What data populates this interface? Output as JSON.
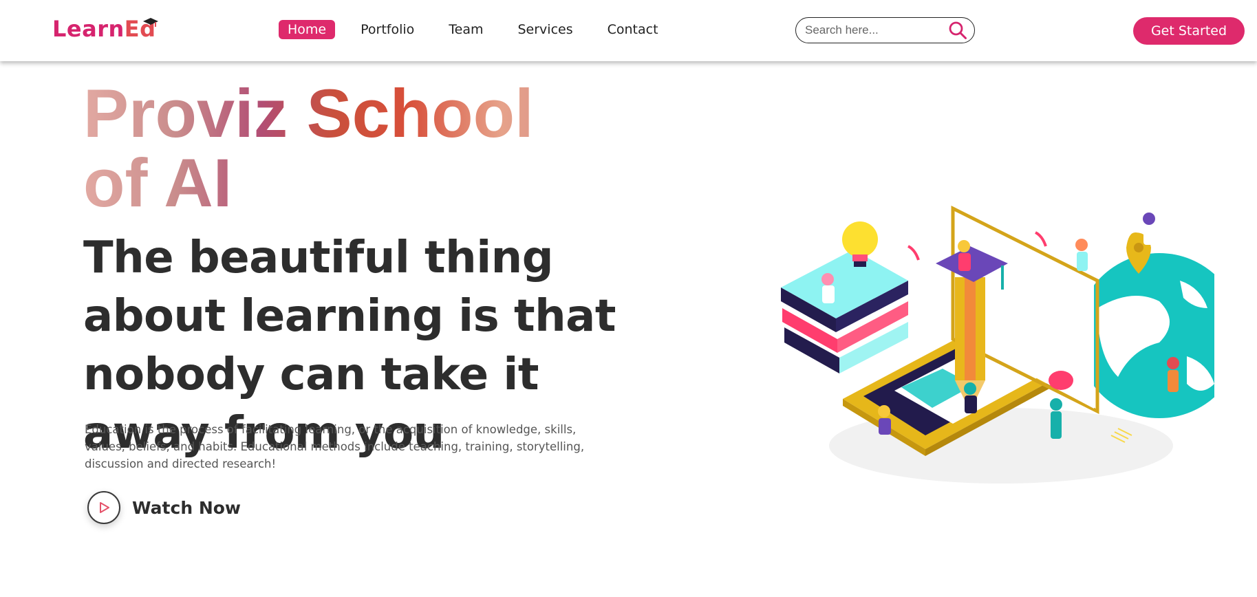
{
  "header": {
    "logo": {
      "part1": "Learn",
      "part2": "Ed"
    },
    "nav": [
      {
        "label": "Home",
        "active": true
      },
      {
        "label": "Portfolio",
        "active": false
      },
      {
        "label": "Team",
        "active": false
      },
      {
        "label": "Services",
        "active": false
      },
      {
        "label": "Contact",
        "active": false
      }
    ],
    "search": {
      "placeholder": "Search here...",
      "value": "",
      "icon": "search-icon"
    },
    "cta_label": "Get Started"
  },
  "hero": {
    "title": "Proviz School of AI",
    "subtitle": "The beautiful thing about learning is that nobody can take it away from you",
    "description": "Education is the process of facilitating learning, or the acquisition of knowledge, skills, values, beliefs, and habits. Educational methods include teaching, training, storytelling, discussion and directed research!",
    "watch_label": "Watch Now",
    "watch_icon": "play-icon"
  },
  "colors": {
    "accent": "#de2a6c",
    "text": "#2d2d2d",
    "muted": "#555555"
  }
}
